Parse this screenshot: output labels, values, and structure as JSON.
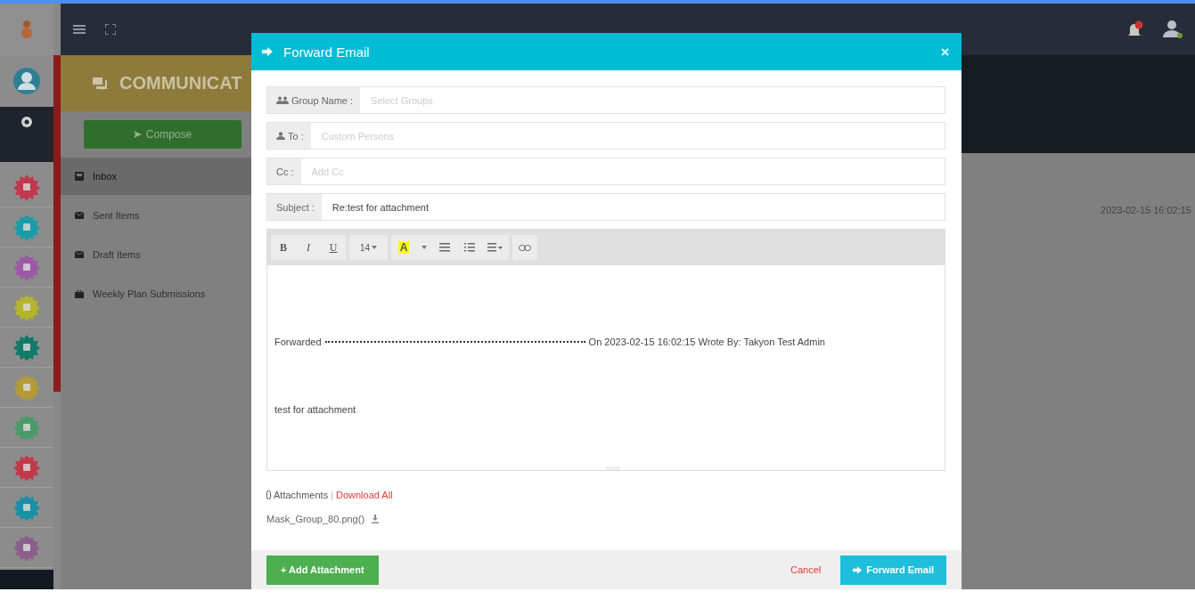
{
  "rail": {
    "apps": [
      {
        "color": "#c0394e"
      },
      {
        "color": "#1a9ba8"
      },
      {
        "color": "#9b59a6"
      },
      {
        "color": "#b5b52b"
      },
      {
        "color": "#137a6a"
      },
      {
        "color": "#b59a35"
      },
      {
        "color": "#4b9a6a"
      },
      {
        "color": "#c03a4a"
      },
      {
        "color": "#1890a5"
      },
      {
        "color": "#8b5f8c"
      }
    ]
  },
  "module": {
    "title": "COMMUNICAT",
    "compose": "Compose",
    "folders": [
      {
        "label": "Inbox",
        "kind": "inbox",
        "selected": true
      },
      {
        "label": "Sent Items",
        "kind": "mail",
        "selected": false
      },
      {
        "label": "Draft Items",
        "kind": "mail",
        "selected": false
      },
      {
        "label": "Weekly Plan Submissions",
        "kind": "bag",
        "selected": false
      }
    ]
  },
  "list": {
    "date": "2023-02-15 16:02:15"
  },
  "modal": {
    "title": "Forward Email",
    "fields": [
      {
        "kind": "group",
        "label": "Group Name :",
        "placeholder": "Select Groups"
      },
      {
        "kind": "person",
        "label": "To :",
        "placeholder": "Custom Persons"
      },
      {
        "kind": "plain",
        "label": "Cc :",
        "placeholder": "Add Cc"
      },
      {
        "kind": "plain",
        "label": "Subject :",
        "value": "Re:test for attachment"
      }
    ],
    "toolbar": [
      {
        "kind": "bold",
        "label": "B"
      },
      {
        "kind": "italic",
        "label": "I"
      },
      {
        "kind": "underline",
        "label": "U"
      },
      {
        "kind": "size",
        "label": "14"
      },
      {
        "kind": "color",
        "label": "A"
      },
      {
        "kind": "ul"
      },
      {
        "kind": "ol"
      },
      {
        "kind": "align"
      },
      {
        "kind": "link"
      }
    ],
    "body": {
      "lead": "Forwarded",
      "header": "On 2023-02-15 16:02:15 Wrote By: Takyon Test Admin",
      "text": "test for attachment"
    },
    "attachments": {
      "label": "Attachments",
      "separator": "|",
      "download_all": "Download All",
      "files": [
        "Mask_Group_80.png()"
      ]
    },
    "add_button": "+ Add Attachment",
    "cancel": "Cancel",
    "submit": "Forward Email"
  }
}
